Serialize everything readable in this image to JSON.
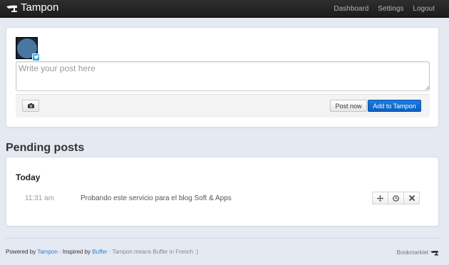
{
  "app": {
    "name": "Tampon",
    "logo_icon": "tampon-stamp-icon"
  },
  "nav": {
    "items": [
      {
        "label": "Dashboard"
      },
      {
        "label": "Settings"
      },
      {
        "label": "Logout"
      }
    ]
  },
  "composer": {
    "avatar_icon": "user-avatar",
    "network_icon": "twitter-icon",
    "placeholder": "Write your post here",
    "value": "",
    "camera_icon": "camera-icon",
    "post_now_label": "Post now",
    "add_label": "Add to Tampon"
  },
  "pending": {
    "title": "Pending posts",
    "groups": [
      {
        "day": "Today",
        "posts": [
          {
            "time": "11:31 am",
            "text": "Probando este servicio para el blog Soft & Apps",
            "actions": [
              "move-icon",
              "clock-icon",
              "delete-icon"
            ]
          }
        ]
      }
    ]
  },
  "footer": {
    "powered_by": "Powered by",
    "tampon_link": "Tampon",
    "inspired_by": "· Inspired by",
    "buffer_link": "Buffer",
    "tagline": "· Tampon means Buffer in French :)",
    "bookmarklet": "Bookmarklet",
    "bookmarklet_icon": "tampon-stamp-icon"
  },
  "colors": {
    "navbar": "#1c1c1c",
    "background": "#e4e9f2",
    "primary_button": "#0d60c4",
    "link": "#2a7bd4",
    "twitter": "#2ca7e0"
  }
}
